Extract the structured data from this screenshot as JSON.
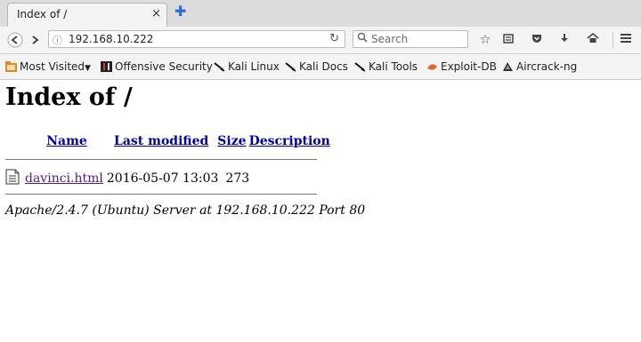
{
  "browser": {
    "tab": {
      "title": "Index of /",
      "close_label": "×"
    },
    "new_tab_label": "✚",
    "url": "192.168.10.222",
    "search_placeholder": "Search",
    "icons": [
      "back-icon",
      "forward-icon",
      "info-icon",
      "reload-icon",
      "search-icon",
      "star-icon",
      "reading-list-icon",
      "pocket-icon",
      "download-icon",
      "home-icon",
      "menu-icon"
    ]
  },
  "bookmarks": [
    {
      "label": "Most Visited",
      "icon": "folder-icon"
    },
    {
      "label": "Offensive Security",
      "icon": "offsec-icon"
    },
    {
      "label": "Kali Linux",
      "icon": "kali-icon"
    },
    {
      "label": "Kali Docs",
      "icon": "kali-icon"
    },
    {
      "label": "Kali Tools",
      "icon": "kali-icon"
    },
    {
      "label": "Exploit-DB",
      "icon": "exploitdb-icon"
    },
    {
      "label": "Aircrack-ng",
      "icon": "aircrack-icon"
    }
  ],
  "page": {
    "heading": "Index of /",
    "columns": {
      "name": "Name",
      "modified": "Last modified",
      "size": "Size",
      "description": "Description"
    },
    "rows": [
      {
        "name": "davinci.html",
        "modified": "2016-05-07 13:03",
        "size": "273",
        "description": ""
      }
    ],
    "footer": "Apache/2.4.7 (Ubuntu) Server at 192.168.10.222 Port 80"
  },
  "colors": {
    "link": "#0000aa",
    "visited": "#551a8b",
    "exploitdb": "#e8622a"
  }
}
